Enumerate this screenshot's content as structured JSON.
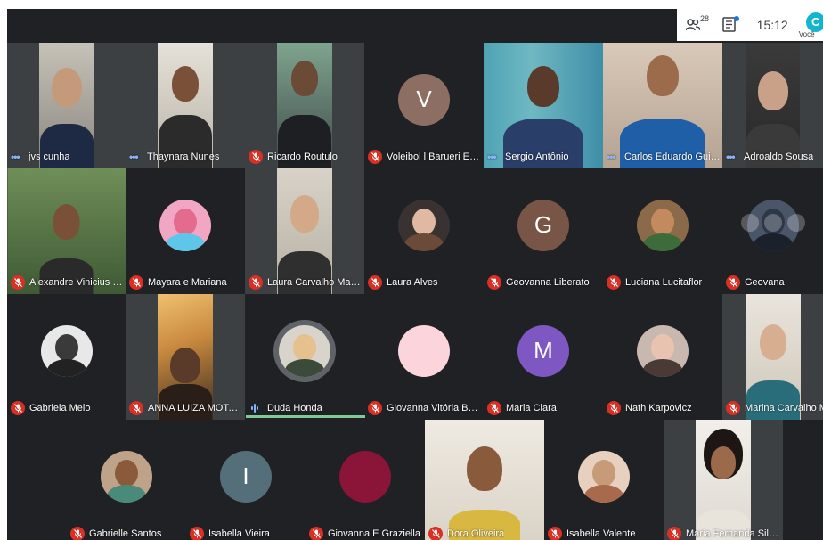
{
  "toolbar": {
    "participants_count": "28",
    "time": "15:12",
    "self_avatar_letter": "C",
    "self_label": "Você"
  },
  "tiles": [
    {
      "name": "jvs cunha",
      "status": "dots"
    },
    {
      "name": "Thaynara Nunes",
      "status": "dots"
    },
    {
      "name": "Ricardo Routulo",
      "status": "muted"
    },
    {
      "name": "Voleibol l Barueri Esporte F...",
      "status": "muted",
      "letter": "V"
    },
    {
      "name": "Sergio Antônio",
      "status": "dots"
    },
    {
      "name": "Carlos Eduardo Guimarães...",
      "status": "dots"
    },
    {
      "name": "Adroaldo Sousa",
      "status": "dots"
    },
    {
      "name": "Alexandre Vinicius De Cam...",
      "status": "muted"
    },
    {
      "name": "Mayara e Mariana",
      "status": "muted"
    },
    {
      "name": "Laura Carvalho Maccarone",
      "status": "muted"
    },
    {
      "name": "Laura Alves",
      "status": "muted"
    },
    {
      "name": "Geovanna Liberato",
      "status": "muted",
      "letter": "G"
    },
    {
      "name": "Luciana Lucitaflor",
      "status": "muted"
    },
    {
      "name": "Geovana",
      "status": "muted"
    },
    {
      "name": "Gabriela Melo",
      "status": "muted"
    },
    {
      "name": "ANNA LUIZA MOTA LIMA ...",
      "status": "muted"
    },
    {
      "name": "Duda Honda",
      "status": "speaking"
    },
    {
      "name": "Giovanna Vitória Baatsch",
      "status": "muted"
    },
    {
      "name": "Maria Clara",
      "status": "muted",
      "letter": "M"
    },
    {
      "name": "Nath Karpovicz",
      "status": "muted"
    },
    {
      "name": "Marina Carvalho Maccarone",
      "status": "muted"
    },
    {
      "name": "Gabrielle Santos",
      "status": "muted"
    },
    {
      "name": "Isabella Vieira",
      "status": "muted",
      "letter": "I"
    },
    {
      "name": "Giovanna E Graziella",
      "status": "muted"
    },
    {
      "name": "Dora Oliveira",
      "status": "muted"
    },
    {
      "name": "Isabella Valente",
      "status": "muted"
    },
    {
      "name": "Maria Fernanda Silva Leite ...",
      "status": "muted"
    }
  ],
  "colors": {
    "background": "#202124",
    "tile": "#3c4043",
    "muted_mic": "#d93025",
    "speaking": "#81c995",
    "avatar_V": "#8d6e63",
    "avatar_G": "#795548",
    "avatar_M": "#7e57c2",
    "avatar_I": "#546e7a",
    "avatar_pink": "#fcd5dc",
    "avatar_maroon": "#8a1538"
  }
}
